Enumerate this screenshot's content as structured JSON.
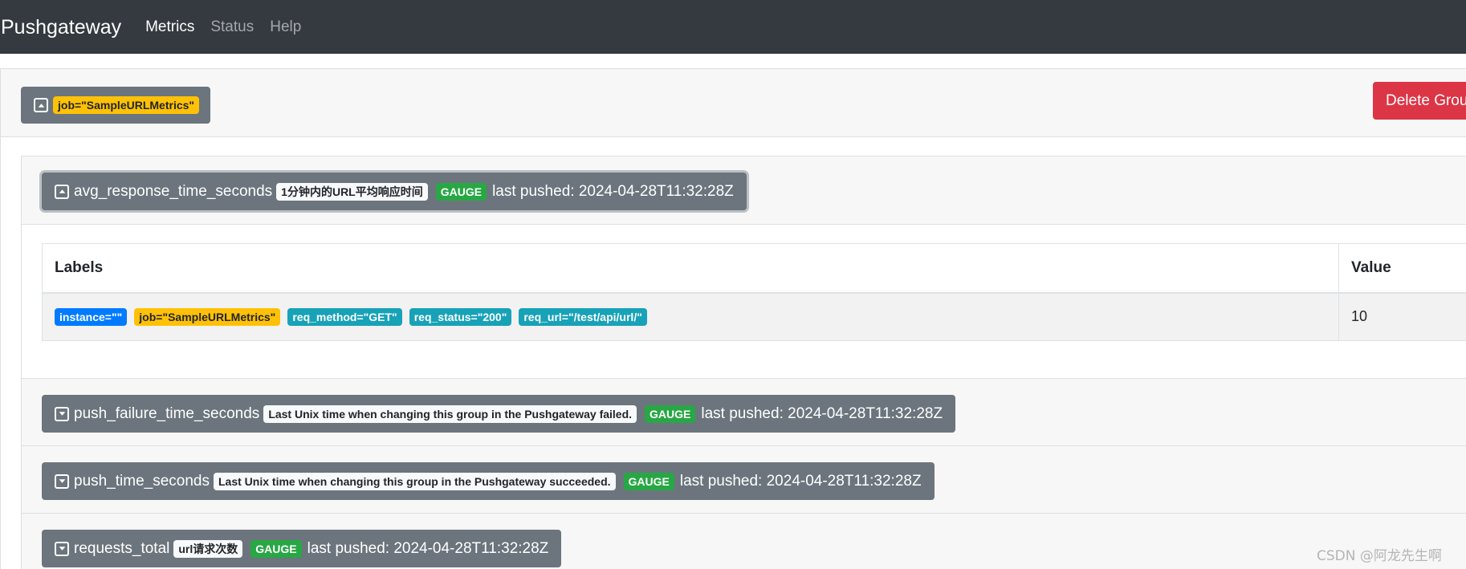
{
  "navbar": {
    "brand": "Pushgateway",
    "links": [
      {
        "label": "Metrics",
        "active": true
      },
      {
        "label": "Status",
        "active": false
      },
      {
        "label": "Help",
        "active": false
      }
    ]
  },
  "group": {
    "label_badge": "job=\"SampleURLMetrics\"",
    "delete_label": "Delete Group"
  },
  "metrics": [
    {
      "name": "avg_response_time_seconds",
      "help": "1分钟内的URL平均响应时间",
      "type": "GAUGE",
      "pushed": "last pushed: 2024-04-28T11:32:28Z",
      "expanded": true
    },
    {
      "name": "push_failure_time_seconds",
      "help": "Last Unix time when changing this group in the Pushgateway failed.",
      "type": "GAUGE",
      "pushed": "last pushed: 2024-04-28T11:32:28Z",
      "expanded": false
    },
    {
      "name": "push_time_seconds",
      "help": "Last Unix time when changing this group in the Pushgateway succeeded.",
      "type": "GAUGE",
      "pushed": "last pushed: 2024-04-28T11:32:28Z",
      "expanded": false
    },
    {
      "name": "requests_total",
      "help": "url请求次数",
      "type": "GAUGE",
      "pushed": "last pushed: 2024-04-28T11:32:28Z",
      "expanded": false
    }
  ],
  "table": {
    "headers": {
      "labels": "Labels",
      "value": "Value"
    },
    "row": {
      "labels": [
        "instance=\"\"",
        "job=\"SampleURLMetrics\"",
        "req_method=\"GET\"",
        "req_status=\"200\"",
        "req_url=\"/test/api/url/\""
      ],
      "value": "10"
    }
  },
  "watermark": "CSDN @阿龙先生啊",
  "colors": {
    "navbar": "#343a40",
    "secondary": "#6c757d",
    "danger": "#dc3545",
    "warning": "#ffc107",
    "success": "#28a745",
    "primary": "#007bff",
    "info": "#17a2b8"
  }
}
